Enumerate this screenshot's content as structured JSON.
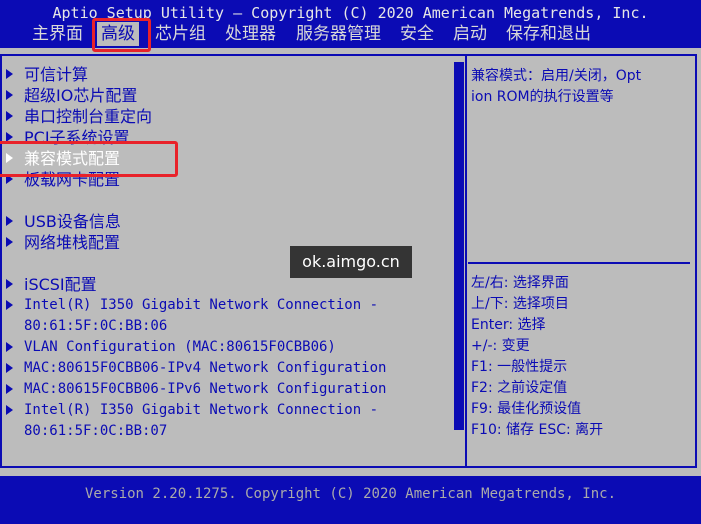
{
  "header": {
    "title": "Aptio Setup Utility – Copyright (C) 2020 American Megatrends, Inc.",
    "menu": [
      {
        "label": "主界面",
        "active": false
      },
      {
        "label": "高级",
        "active": true
      },
      {
        "label": "芯片组",
        "active": false
      },
      {
        "label": "处理器",
        "active": false
      },
      {
        "label": "服务器管理",
        "active": false
      },
      {
        "label": "安全",
        "active": false
      },
      {
        "label": "启动",
        "active": false
      },
      {
        "label": "保存和退出",
        "active": false
      }
    ]
  },
  "main": {
    "items": [
      {
        "label": "可信计算",
        "selected": false
      },
      {
        "label": "超级IO芯片配置",
        "selected": false
      },
      {
        "label": "串口控制台重定向",
        "selected": false
      },
      {
        "label": "PCI子系统设置",
        "selected": false
      },
      {
        "label": "兼容模式配置",
        "selected": true
      },
      {
        "label": "板载网卡配置",
        "selected": false
      },
      {
        "label": "USB设备信息",
        "selected": false
      },
      {
        "label": "网络堆栈配置",
        "selected": false
      },
      {
        "label": "iSCSI配置",
        "selected": false
      },
      {
        "label": "Intel(R) I350 Gigabit Network Connection -",
        "continuation": "80:61:5F:0C:BB:06",
        "selected": false
      },
      {
        "label": "VLAN Configuration (MAC:80615F0CBB06)",
        "selected": false
      },
      {
        "label": "MAC:80615F0CBB06-IPv4 Network Configuration",
        "selected": false
      },
      {
        "label": "MAC:80615F0CBB06-IPv6 Network Configuration",
        "selected": false
      },
      {
        "label": "Intel(R) I350 Gigabit Network Connection -",
        "continuation": "80:61:5F:0C:BB:07",
        "selected": false
      }
    ]
  },
  "help": {
    "text_line1": "兼容模式：启用/关闭，Opt",
    "text_line2": "ion ROM的执行设置等",
    "keys": [
      "左/右: 选择界面",
      "上/下: 选择项目",
      "Enter: 选择",
      "+/-: 变更",
      "F1: 一般性提示",
      "F2: 之前设定值",
      "F9: 最佳化预设值",
      "F10: 储存  ESC: 离开"
    ]
  },
  "footer": {
    "version": "Version 2.20.1275. Copyright (C) 2020 American Megatrends, Inc."
  },
  "watermark": {
    "text": "ok.aimgo.cn"
  },
  "colors": {
    "bios_blue": "#0b0bb4",
    "bios_gray": "#bcbcbc",
    "highlight_red": "#e8222a",
    "selected_text": "#ffffff"
  }
}
